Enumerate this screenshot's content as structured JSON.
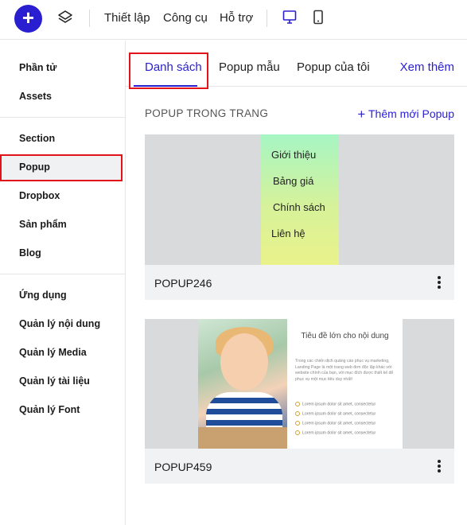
{
  "topbar": {
    "add_label": "+",
    "menu": [
      "Thiết lập",
      "Công cụ",
      "Hỗ trợ"
    ]
  },
  "sidebar": {
    "groups": [
      [
        "Phần tử",
        "Assets"
      ],
      [
        "Section",
        "Popup",
        "Dropbox",
        "Sản phẩm",
        "Blog"
      ],
      [
        "Ứng dụng",
        "Quản lý nội dung",
        "Quản lý Media",
        "Quản lý tài liệu",
        "Quản lý Font"
      ]
    ],
    "active": "Popup"
  },
  "tabs": {
    "items": [
      "Danh sách",
      "Popup mẫu",
      "Popup của tôi"
    ],
    "active": "Danh sách",
    "see_more": "Xem thêm"
  },
  "section": {
    "title": "POPUP TRONG TRANG",
    "add_label": "Thêm mới Popup"
  },
  "popups": [
    {
      "name": "POPUP246",
      "menu_items": [
        "Giới thiệu",
        "Bảng giá",
        "Chính sách",
        "Liên hệ"
      ]
    },
    {
      "name": "POPUP459",
      "preview_title": "Tiêu đề lớn cho nội dung",
      "preview_body": "Trong các chiến dịch quảng cáo phục vụ marketing, Landing Page là một trang web đơn độc lập khác với website chính của bạn, với mục đích được thiết kế để phục vụ một mục tiêu duy nhất!",
      "preview_bullets": [
        "Lorem ipsum dolor sit amet, consectetur",
        "Lorem ipsum dolor sit amet, consectetur",
        "Lorem ipsum dolor sit amet, consectetur",
        "Lorem ipsum dolor sit amet, consectetur"
      ]
    }
  ],
  "colors": {
    "accent": "#2a1fd0",
    "highlight": "#e2141a"
  }
}
